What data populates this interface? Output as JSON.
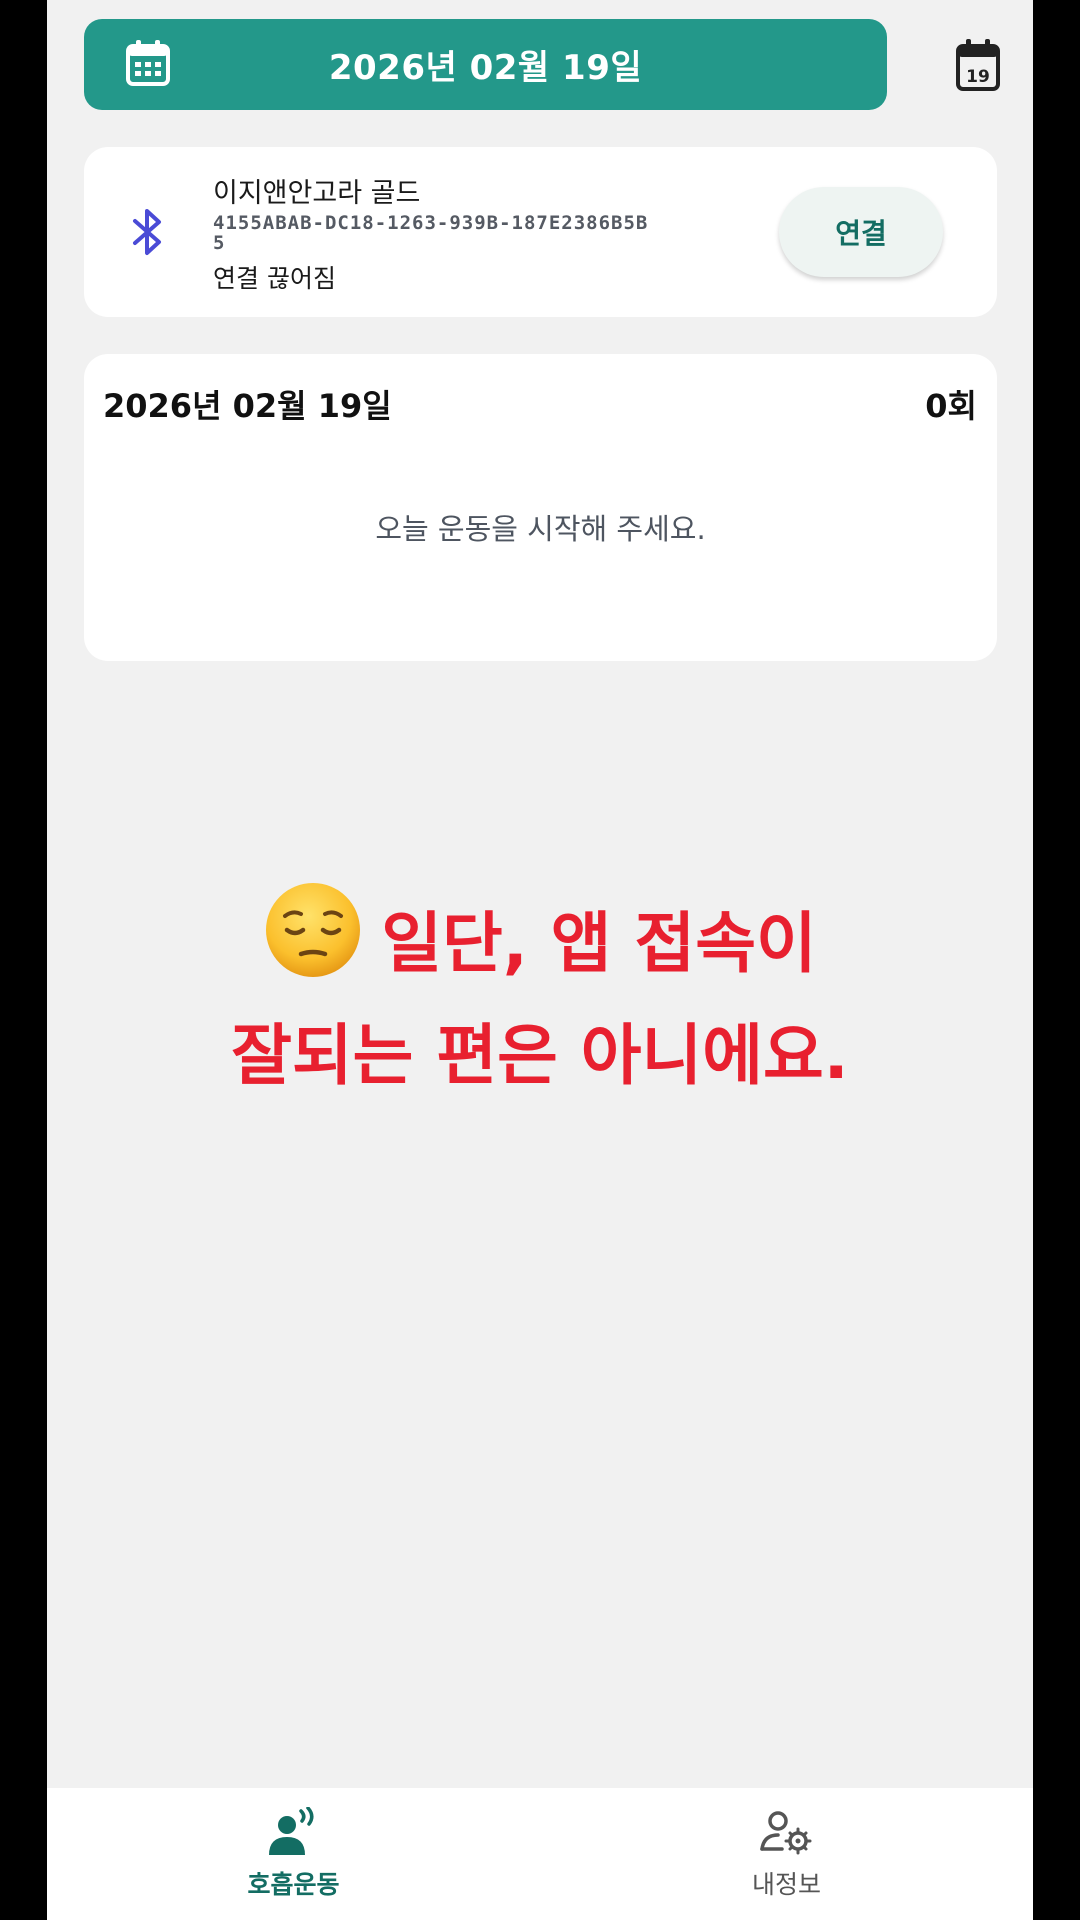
{
  "header": {
    "date_label": "2026년 02월 19일",
    "calendar_icon": "calendar-icon",
    "today_icon": "calendar-today-icon",
    "today_day": "19",
    "accent_color": "#23988a"
  },
  "device": {
    "name": "이지앤안고라 골드",
    "uuid": "4155ABAB-DC18-1263-939B-187E2386B5B5",
    "status": "연결 끊어짐",
    "connect_label": "연결",
    "icon": "bluetooth-icon",
    "icon_color": "#4a4bd6"
  },
  "summary": {
    "date_label": "2026년 02월 19일",
    "count_label": "0회",
    "empty_message": "오늘 운동을 시작해 주세요."
  },
  "caption": {
    "line1": "일단, 앱 접속이",
    "line2": "잘되는 편은 아니에요.",
    "emoji": "pensive-face-emoji",
    "color": "#e8202f"
  },
  "bottom_nav": {
    "items": [
      {
        "label": "호흡운동",
        "icon": "breathing-exercise-icon",
        "active": true
      },
      {
        "label": "내정보",
        "icon": "user-settings-icon",
        "active": false
      }
    ]
  }
}
